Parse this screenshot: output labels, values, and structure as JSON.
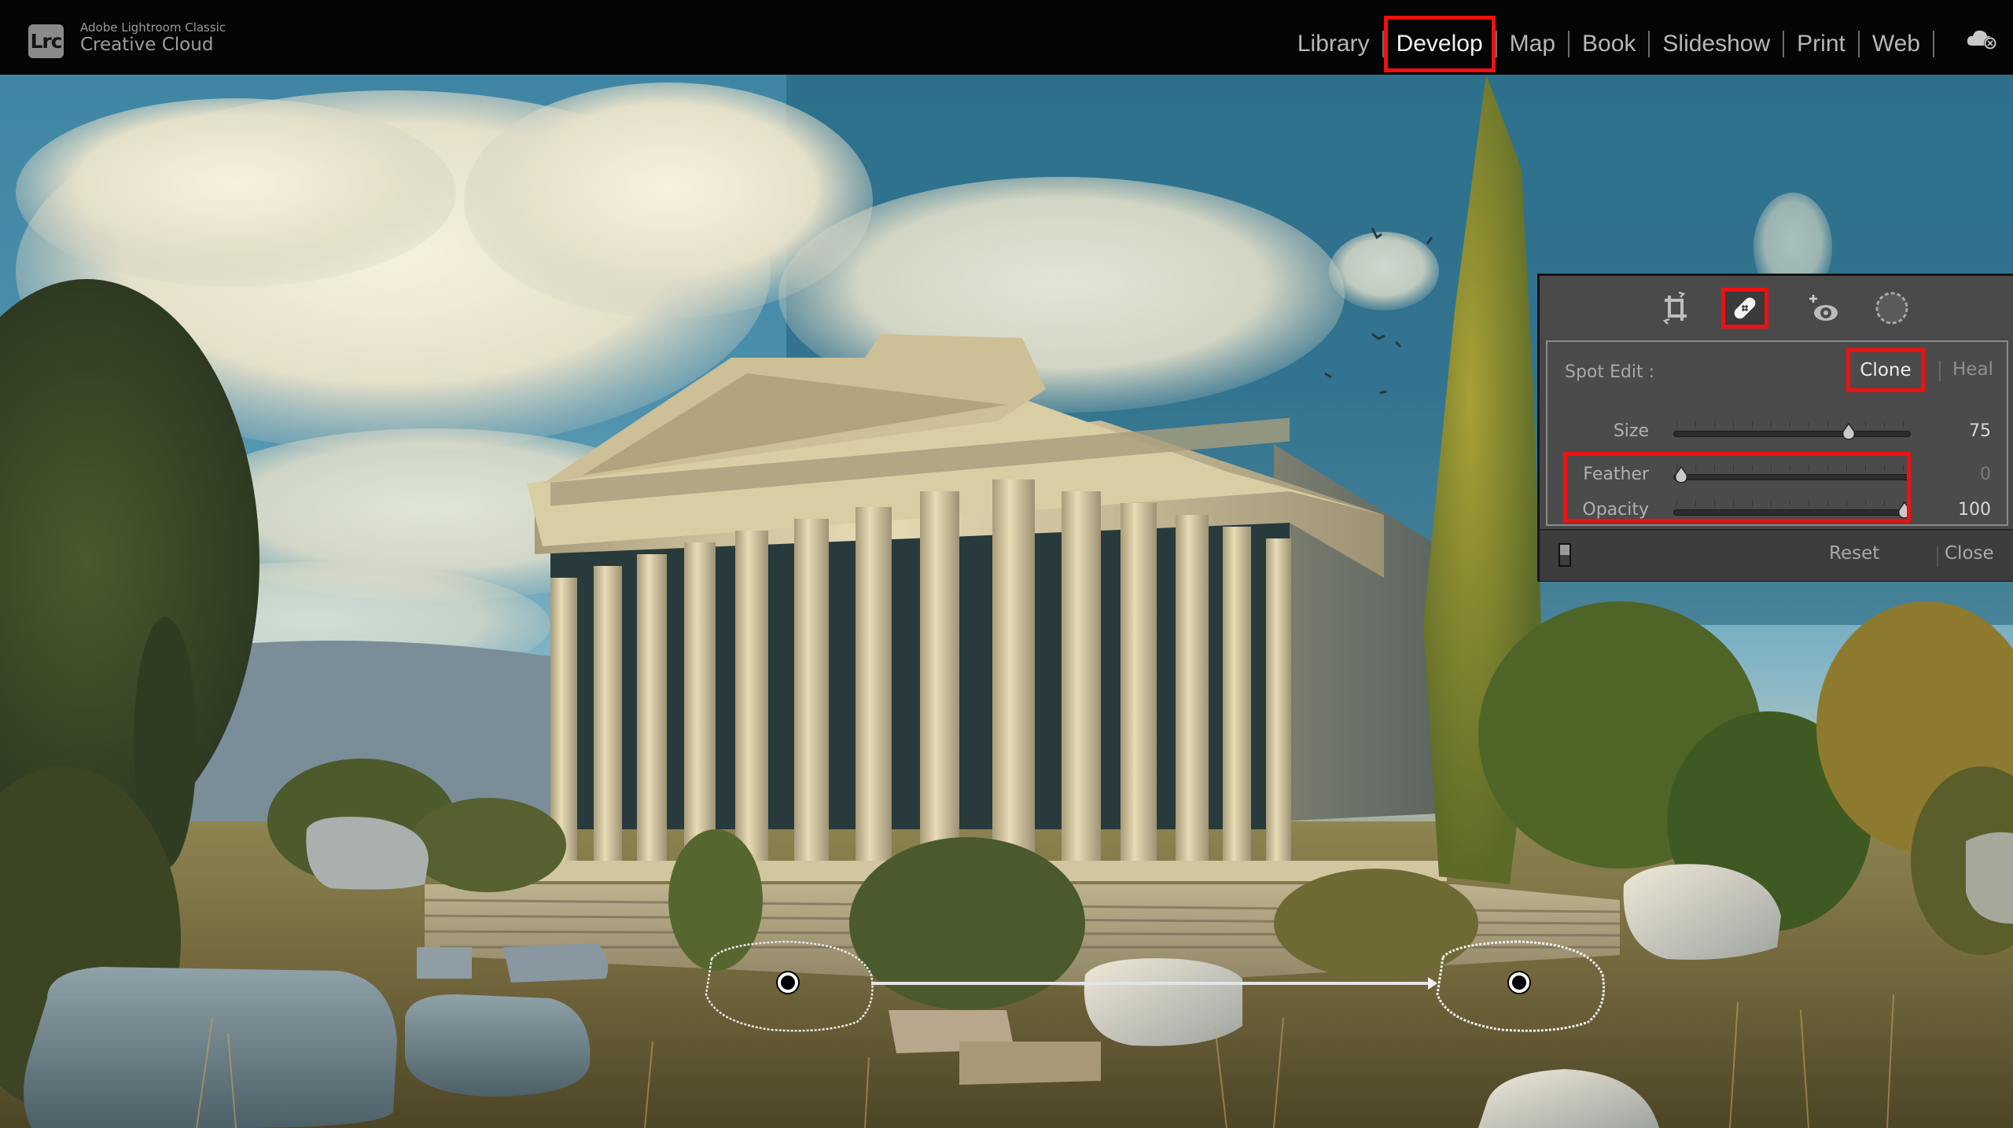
{
  "app": {
    "logo_text": "Lrc",
    "product_name": "Adobe Lightroom Classic",
    "account_label": "Creative Cloud"
  },
  "modules": [
    {
      "label": "Library",
      "active": false
    },
    {
      "label": "Develop",
      "active": true
    },
    {
      "label": "Map",
      "active": false
    },
    {
      "label": "Book",
      "active": false
    },
    {
      "label": "Slideshow",
      "active": false
    },
    {
      "label": "Print",
      "active": false
    },
    {
      "label": "Web",
      "active": false
    }
  ],
  "sync_icon": "cloud-sync-paused-icon",
  "tool_strip": {
    "tools": [
      {
        "name": "crop-overlay",
        "icon": "crop-icon",
        "active": false
      },
      {
        "name": "spot-removal",
        "icon": "bandage-icon",
        "active": true
      },
      {
        "name": "red-eye-correction",
        "icon": "red-eye-icon",
        "active": false
      },
      {
        "name": "masking",
        "icon": "mask-circle-icon",
        "active": false
      }
    ]
  },
  "spot_edit": {
    "label": "Spot Edit :",
    "modes": {
      "clone": "Clone",
      "heal": "Heal"
    },
    "selected_mode": "Clone",
    "sliders": [
      {
        "label": "Size",
        "value": "75",
        "fraction": 0.75,
        "highlighted": false
      },
      {
        "label": "Feather",
        "value": "0",
        "fraction": 0.0,
        "highlighted": true
      },
      {
        "label": "Opacity",
        "value": "100",
        "fraction": 1.0,
        "highlighted": true
      }
    ],
    "footer": {
      "reset_label": "Reset",
      "close_label": "Close"
    }
  },
  "annotation_color": "#ee1111",
  "photo": {
    "subject": "Greek temple ruins with columns, cypress trees, stones and grass under a cloudy blue sky",
    "clone_spot": {
      "source_pin": "source-pin",
      "target_pin": "target-pin"
    }
  }
}
